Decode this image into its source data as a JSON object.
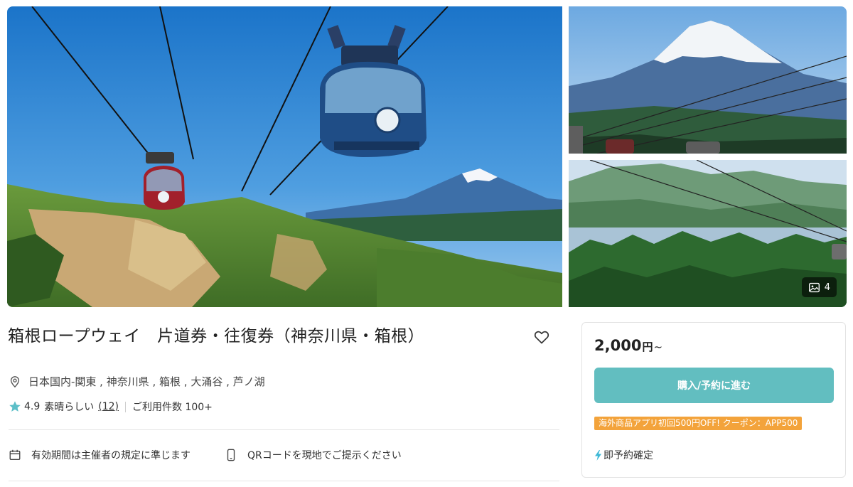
{
  "gallery": {
    "more_photos_count": "4"
  },
  "product": {
    "title": "箱根ロープウェイ　片道券・往復券（神奈川県・箱根）",
    "location": "日本国内-関東 , 神奈川県 , 箱根 , 大涌谷 , 芦ノ湖",
    "rating_score": "4.9",
    "rating_label": "素晴らしい",
    "review_count": "(12)",
    "usage_count": "ご利用件数 100+",
    "features": {
      "validity": "有効期間は主催者の規定に準じます",
      "ticket": "QRコードを現地でご提示ください"
    }
  },
  "purchase": {
    "price_amount": "2,000",
    "price_unit": "円",
    "price_suffix": "~",
    "buy_label": "購入/予約に進む",
    "coupon_text": "海外商品アプリ初回500円OFF! クーポン：APP500",
    "instant_label": "即予約確定"
  },
  "colors": {
    "accent": "#62bec0",
    "star": "#5cbfc8",
    "coupon": "#f3a33b",
    "instant_bolt": "#3db8d6"
  }
}
